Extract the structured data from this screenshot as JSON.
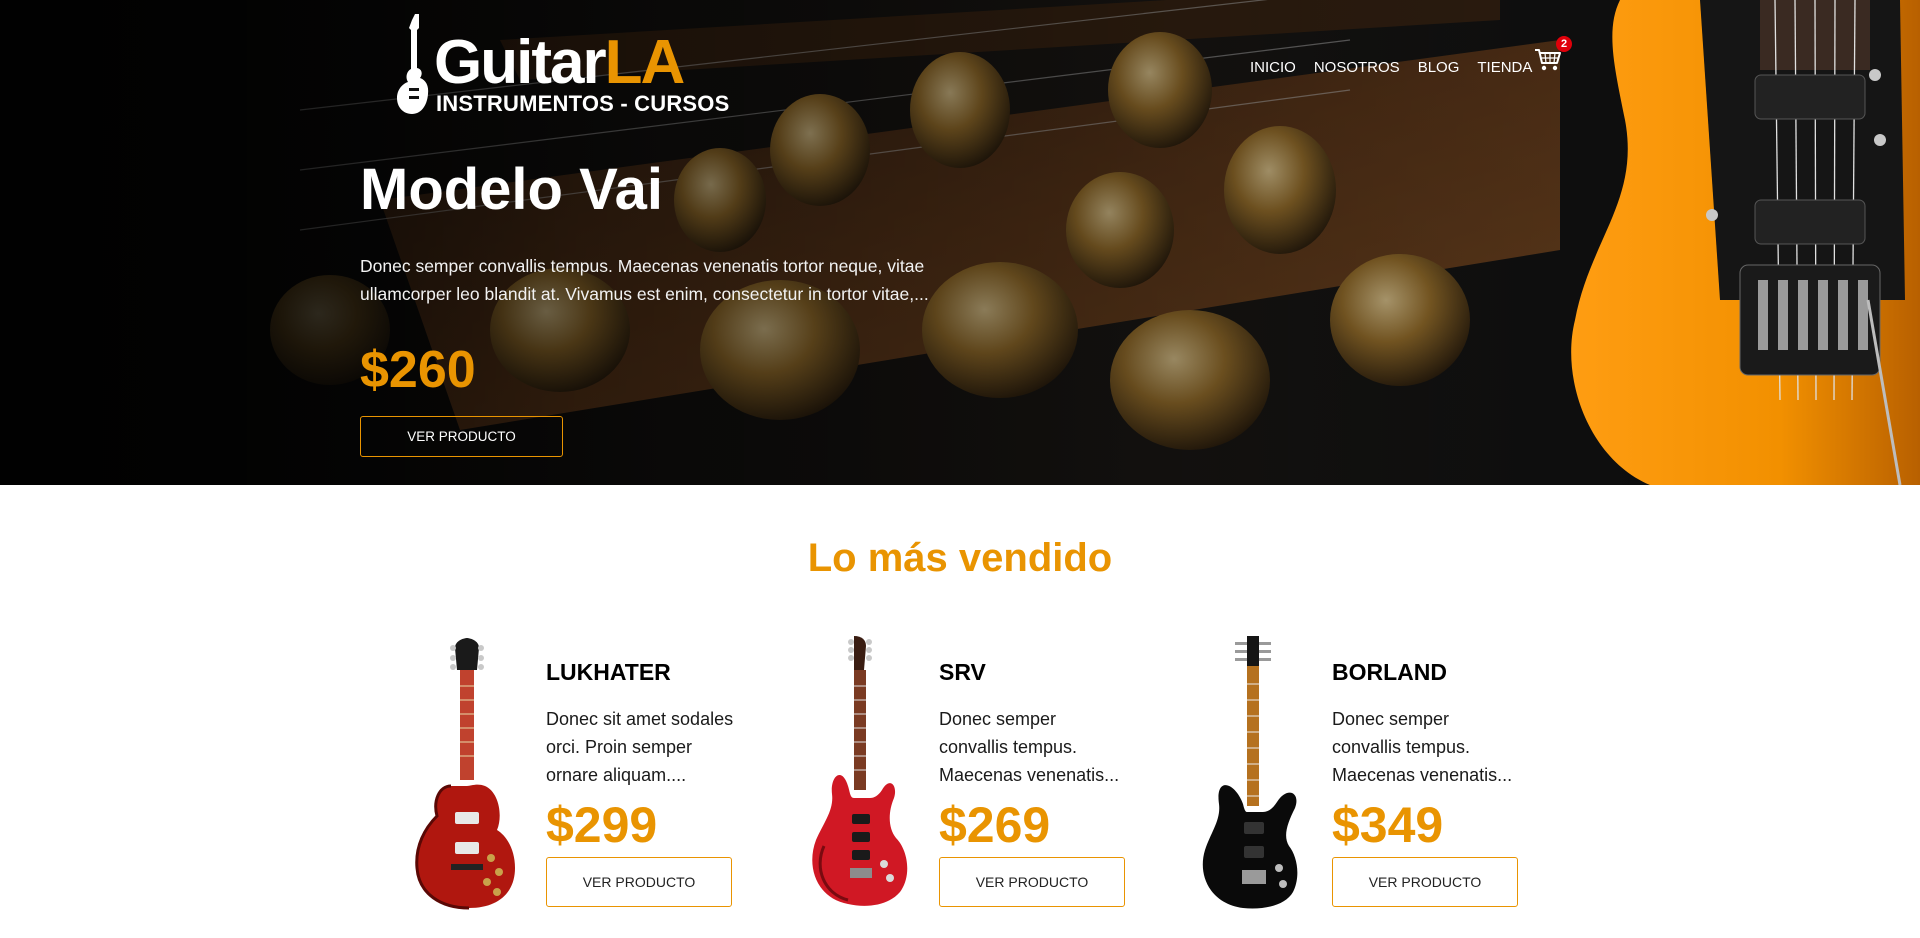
{
  "brand": {
    "name_part1": "Guitar",
    "name_part2": "LA",
    "tagline": "INSTRUMENTOS - CURSOS",
    "accent_color": "#e99401"
  },
  "nav": {
    "items": [
      {
        "label": "INICIO"
      },
      {
        "label": "NOSOTROS"
      },
      {
        "label": "BLOG"
      },
      {
        "label": "TIENDA"
      }
    ],
    "cart_icon": "shopping-cart-icon",
    "cart_count": "2"
  },
  "hero": {
    "title": "Modelo Vai",
    "description": "Donec semper convallis tempus. Maecenas venenatis tortor neque, vitae ullamcorper leo blandit at. Vivamus est enim, consectetur in tortor vitae,...",
    "price": "$260",
    "button_label": "VER PRODUCTO"
  },
  "best_sellers": {
    "title": "Lo más vendido",
    "products": [
      {
        "name": "LUKHATER",
        "description": "Donec sit amet sodales orci. Proin semper ornare aliquam....",
        "price": "$299",
        "button_label": "VER PRODUCTO",
        "body_color": "#b0170f"
      },
      {
        "name": "SRV",
        "description": "Donec semper convallis tempus. Maecenas venenatis...",
        "price": "$269",
        "button_label": "VER PRODUCTO",
        "body_color": "#d01824"
      },
      {
        "name": "BORLAND",
        "description": "Donec semper convallis tempus. Maecenas venenatis...",
        "price": "$349",
        "button_label": "VER PRODUCTO",
        "body_color": "#0a0a0a"
      }
    ]
  }
}
